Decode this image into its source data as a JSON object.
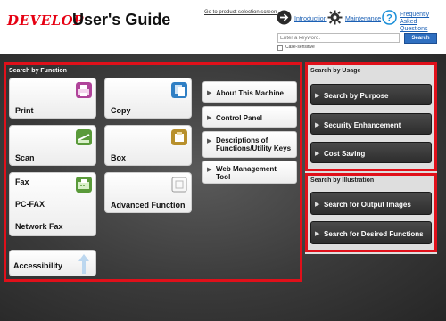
{
  "header": {
    "logo": "DEVELOP",
    "title": "User's Guide",
    "product_link": "Go to product selection screen",
    "links": {
      "introduction": "Introduction",
      "maintenance": "Maintenance",
      "faq_line1": "Frequently",
      "faq_line2": "Asked Questions"
    },
    "search_placeholder": "Enter a keyword.",
    "search_button": "Search",
    "case_sensitive": "Case-sensitive"
  },
  "function_section": {
    "title": "Search by Function",
    "tiles": {
      "print": "Print",
      "copy": "Copy",
      "scan": "Scan",
      "box": "Box",
      "fax": "Fax",
      "pc_fax": "PC-FAX",
      "network_fax": "Network Fax",
      "advanced": "Advanced Function",
      "accessibility": "Accessibility"
    },
    "list": {
      "about": "About This Machine",
      "control_panel": "Control Panel",
      "descriptions_line1": "Descriptions of",
      "descriptions_line2": "Functions/Utility Keys",
      "web_line1": "Web Management",
      "web_line2": "Tool"
    }
  },
  "usage_section": {
    "title": "Search by Usage",
    "buttons": [
      "Search by Purpose",
      "Security Enhancement",
      "Cost Saving"
    ]
  },
  "illustration_section": {
    "title": "Search by Illustration",
    "buttons": [
      "Search for Output Images",
      "Search for Desired Functions"
    ]
  },
  "colors": {
    "brand_red": "#e60012",
    "highlight_frame": "#e0101a",
    "link_blue": "#1a5fb4",
    "search_blue": "#2f6fc0"
  }
}
